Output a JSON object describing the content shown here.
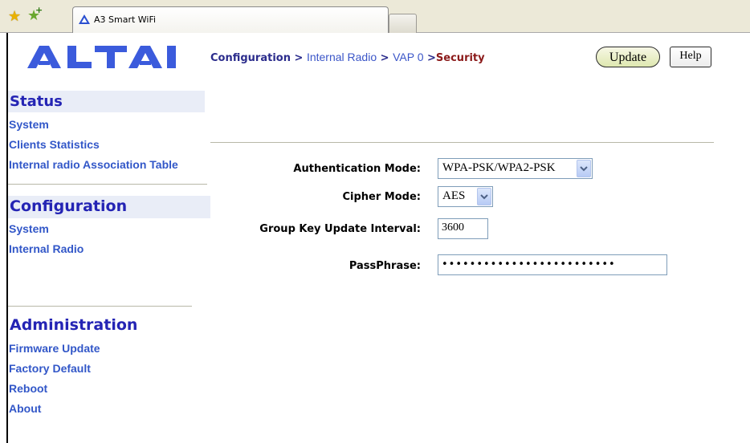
{
  "browser": {
    "tab_title": "A3 Smart WiFi"
  },
  "header": {
    "logo_text": "ALTAI",
    "breadcrumb": {
      "root": "Configuration",
      "sep1": ">",
      "level2": "Internal Radio",
      "sep2": ">",
      "level3": "VAP 0",
      "sep3": ">",
      "current": "Security"
    },
    "update_label": "Update",
    "help_label": "Help"
  },
  "sidebar": {
    "status": {
      "title": "Status",
      "items": [
        "System",
        "Clients Statistics",
        "Internal radio Association Table"
      ]
    },
    "configuration": {
      "title": "Configuration",
      "items": [
        "System",
        "Internal Radio"
      ]
    },
    "administration": {
      "title": "Administration",
      "items": [
        "Firmware Update",
        "Factory Default",
        "Reboot",
        "About"
      ]
    }
  },
  "form": {
    "auth_mode_label": "Authentication Mode:",
    "auth_mode_value": "WPA-PSK/WPA2-PSK",
    "cipher_mode_label": "Cipher Mode:",
    "cipher_mode_value": "AES",
    "group_key_label": "Group Key Update Interval:",
    "group_key_value": "3600",
    "passphrase_label": "PassPhrase:",
    "passphrase_value": "•••••••••••••••••••••••••"
  },
  "colors": {
    "brand": "#3b5bdc",
    "section_title": "#2424b4",
    "link": "#3257c8",
    "current_crumb": "#8b1a1a"
  }
}
